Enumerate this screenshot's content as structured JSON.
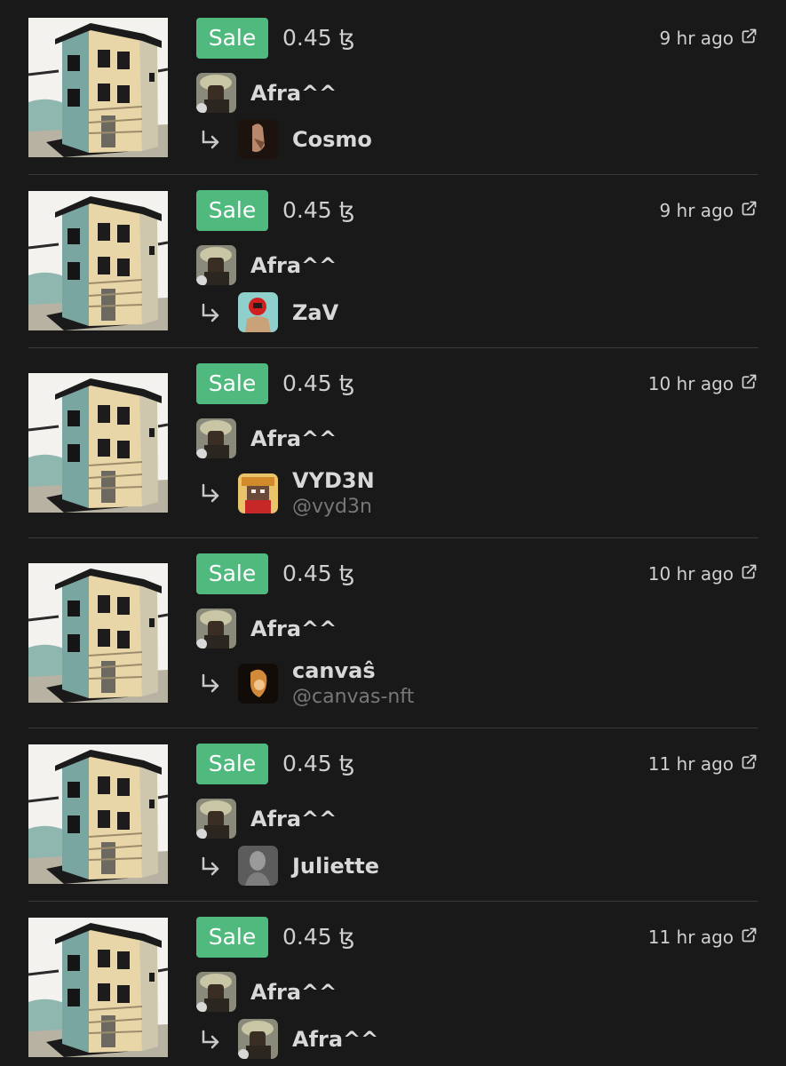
{
  "rows": [
    {
      "type": "Sale",
      "price": "0.45 ꜩ",
      "time": "9 hr ago",
      "seller": "Afra^^",
      "buyer": "Cosmo",
      "buyer_handle": ""
    },
    {
      "type": "Sale",
      "price": "0.45 ꜩ",
      "time": "9 hr ago",
      "seller": "Afra^^",
      "buyer": "ZaV",
      "buyer_handle": ""
    },
    {
      "type": "Sale",
      "price": "0.45 ꜩ",
      "time": "10 hr ago",
      "seller": "Afra^^",
      "buyer": "VYD3N",
      "buyer_handle": "@vyd3n"
    },
    {
      "type": "Sale",
      "price": "0.45 ꜩ",
      "time": "10 hr ago",
      "seller": "Afra^^",
      "buyer": "canvaŝ",
      "buyer_handle": "@canvas-nft"
    },
    {
      "type": "Sale",
      "price": "0.45 ꜩ",
      "time": "11 hr ago",
      "seller": "Afra^^",
      "buyer": "Juliette",
      "buyer_handle": ""
    },
    {
      "type": "Sale",
      "price": "0.45 ꜩ",
      "time": "11 hr ago",
      "seller": "Afra^^",
      "buyer": "Afra^^",
      "buyer_handle": ""
    }
  ],
  "colors": {
    "background": "#191919",
    "sale_badge": "#4fb97e",
    "divider": "#3a3a3a",
    "handle_text": "#777777"
  },
  "icons": {
    "thumbnail": "building-artwork",
    "external": "external-link-icon",
    "transfer": "arrow-return-icon"
  }
}
